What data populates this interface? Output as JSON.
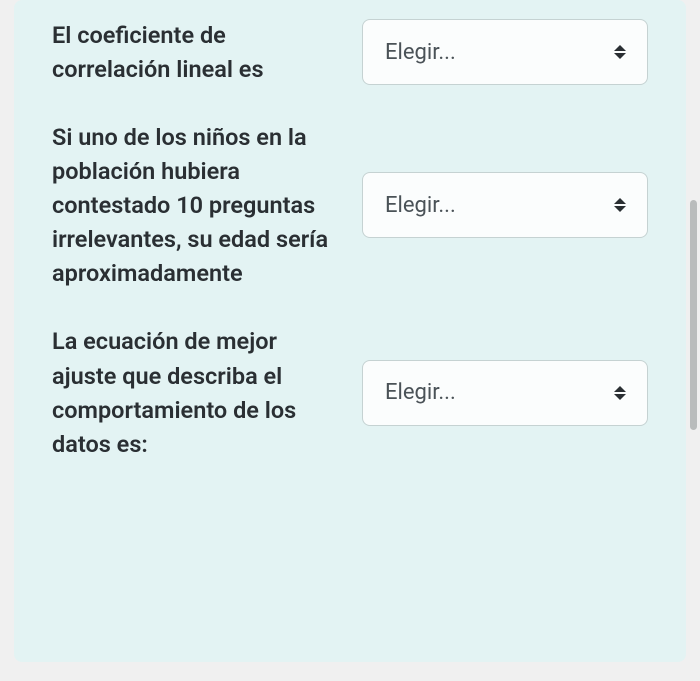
{
  "questions": [
    {
      "label": "El coeficiente de correlación lineal es",
      "placeholder": "Elegir..."
    },
    {
      "label": "Si uno de los niños en la población hubiera contestado 10 preguntas irrelevantes, su edad sería aproximadamente",
      "placeholder": "Elegir..."
    },
    {
      "label": "La ecuación de mejor ajuste que describa el comportamiento de los datos es:",
      "placeholder": "Elegir..."
    }
  ]
}
